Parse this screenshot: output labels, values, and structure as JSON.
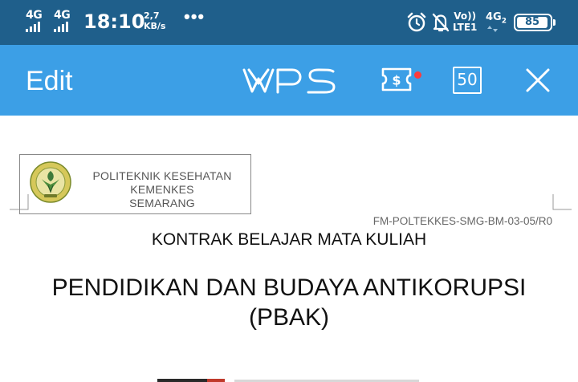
{
  "status_bar": {
    "sim1_network": "4G",
    "sim2_network": "4G",
    "time": "18:10",
    "speed_value": "2,7",
    "speed_unit": "KB/s",
    "more": "•••",
    "volte_top": "Vo))",
    "volte_bottom": "LTE1",
    "network_type": "4G",
    "network_sub": "2",
    "battery_level": "85"
  },
  "toolbar": {
    "edit_label": "Edit",
    "app_logo": "WPS",
    "ticket_icon": "ticket-dollar-icon",
    "badge_value": "50",
    "close_icon": "close-icon",
    "accent_color": "#3c9fe6",
    "notification_color": "#ff3b3b"
  },
  "document": {
    "institution_lines": [
      "POLITEKNIK KESEHATAN",
      "KEMENKES",
      "SEMARANG"
    ],
    "form_code": "FM-POLTEKKES-SMG-BM-03-05/R0",
    "title": "KONTRAK BELAJAR MATA KULIAH",
    "course_line1": "PENDIDIKAN DAN BUDAYA ANTIKORUPSI",
    "course_line2": "(PBAK)"
  }
}
